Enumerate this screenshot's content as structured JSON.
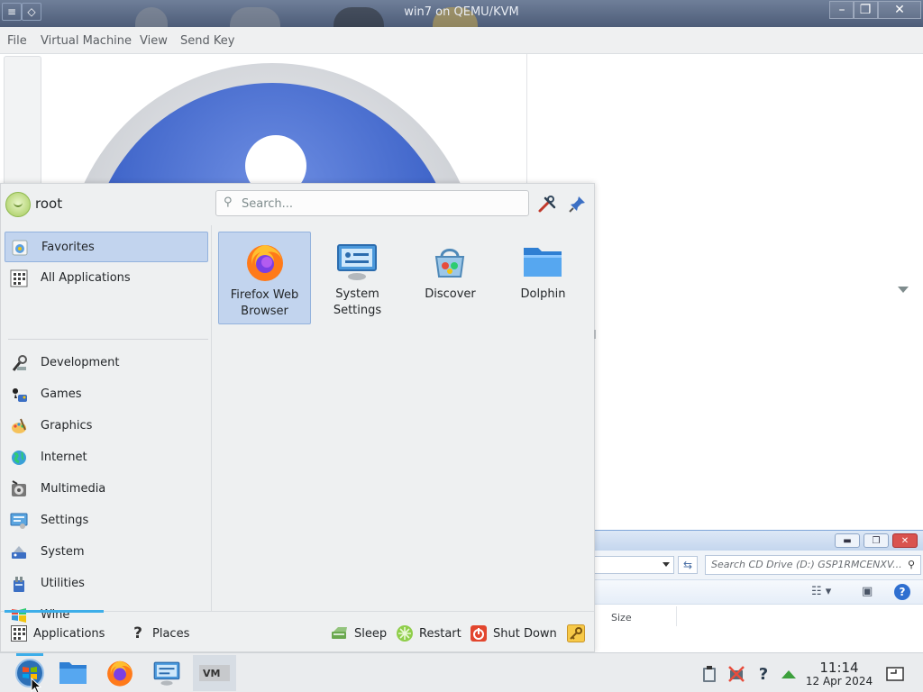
{
  "vm_window": {
    "title": "win7 on QEMU/KVM",
    "menu": [
      "File",
      "Virtual Machine",
      "View",
      "Send Key"
    ]
  },
  "explorer": {
    "search_placeholder": "Search CD Drive (D:) GSP1RMCENXV...",
    "column_size": "Size"
  },
  "launcher": {
    "user_name": "root",
    "search_placeholder": "Search...",
    "categories": [
      {
        "label": "Favorites",
        "icon": "favorites-icon"
      },
      {
        "label": "All Applications",
        "icon": "grid-icon"
      },
      {
        "label": "Development",
        "icon": "development-icon"
      },
      {
        "label": "Games",
        "icon": "games-icon"
      },
      {
        "label": "Graphics",
        "icon": "graphics-icon"
      },
      {
        "label": "Internet",
        "icon": "internet-icon"
      },
      {
        "label": "Multimedia",
        "icon": "multimedia-icon"
      },
      {
        "label": "Settings",
        "icon": "settings-icon"
      },
      {
        "label": "System",
        "icon": "system-icon"
      },
      {
        "label": "Utilities",
        "icon": "utilities-icon"
      },
      {
        "label": "Wine",
        "icon": "wine-icon"
      }
    ],
    "favorites": [
      {
        "label": "Firefox Web Browser",
        "icon": "firefox-icon"
      },
      {
        "label": "System Settings",
        "icon": "system-settings-icon"
      },
      {
        "label": "Discover",
        "icon": "discover-icon"
      },
      {
        "label": "Dolphin",
        "icon": "dolphin-folder-icon"
      }
    ],
    "footer": {
      "applications": "Applications",
      "places": "Places",
      "sleep": "Sleep",
      "restart": "Restart",
      "shutdown": "Shut Down"
    }
  },
  "taskbar": {
    "time": "11:14",
    "date": "12 Apr 2024"
  },
  "colors": {
    "selection": "#c2d4ee",
    "accent": "#3daee9",
    "panel": "#eef0f1"
  }
}
